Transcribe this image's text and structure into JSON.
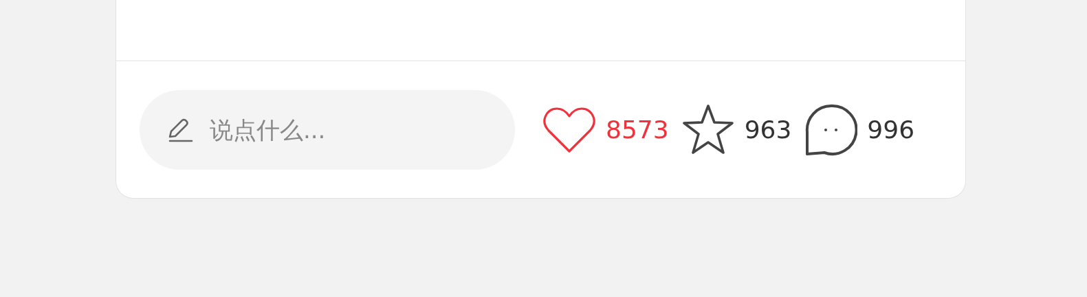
{
  "comment_box": {
    "placeholder": "说点什么..."
  },
  "actions": [
    {
      "kind": "like",
      "count": "8573",
      "active": true
    },
    {
      "kind": "favorite",
      "count": "963",
      "active": false
    },
    {
      "kind": "comment",
      "count": "996",
      "active": false
    }
  ]
}
